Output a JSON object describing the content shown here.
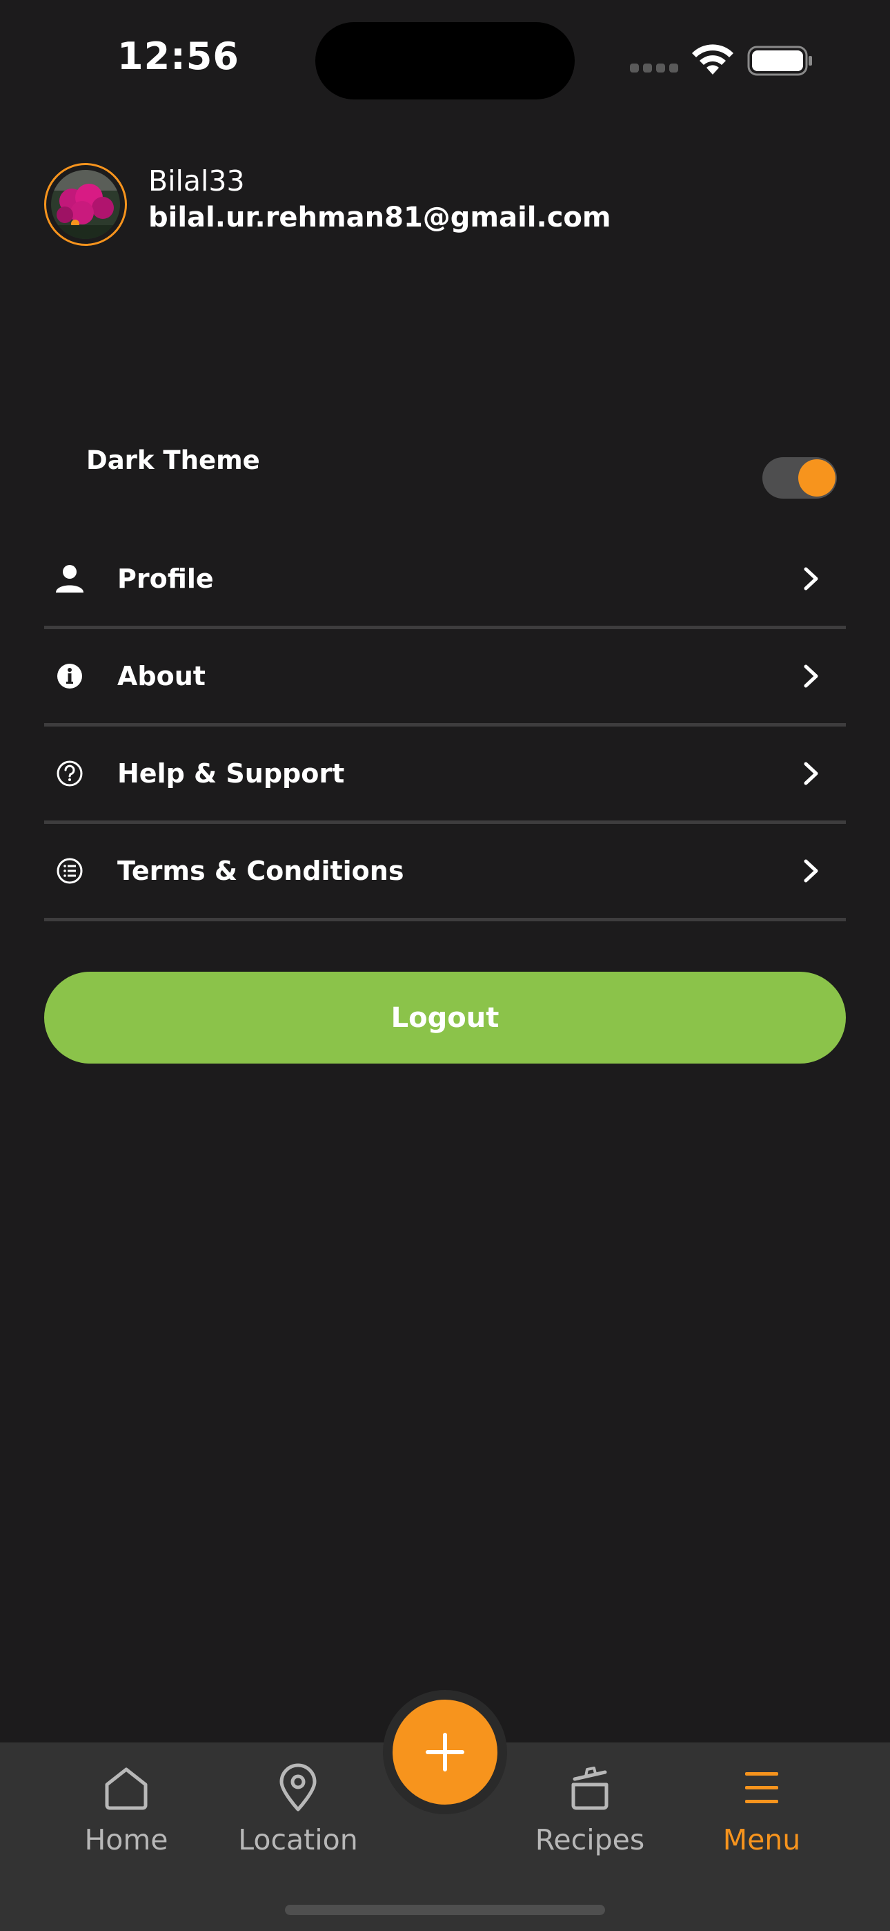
{
  "status_bar": {
    "time": "12:56"
  },
  "profile": {
    "username": "Bilal33",
    "email": "bilal.ur.rehman81@gmail.com"
  },
  "settings": {
    "dark_theme_label": "Dark Theme",
    "dark_theme_enabled": true
  },
  "menu": {
    "items": [
      {
        "label": "Profile",
        "icon": "person-icon"
      },
      {
        "label": "About",
        "icon": "info-icon"
      },
      {
        "label": "Help & Support",
        "icon": "help-icon"
      },
      {
        "label": "Terms & Conditions",
        "icon": "list-icon"
      }
    ]
  },
  "logout_label": "Logout",
  "bottom_nav": {
    "items": [
      {
        "label": "Home",
        "icon": "home-icon"
      },
      {
        "label": "Location",
        "icon": "location-pin-icon"
      },
      {
        "label": "Recipes",
        "icon": "cooking-pot-icon"
      },
      {
        "label": "Menu",
        "icon": "menu-icon",
        "active": true
      }
    ],
    "add_icon": "plus-icon"
  },
  "colors": {
    "background": "#1c1b1c",
    "accent": "#f7941d",
    "logout": "#8bc34a",
    "nav_background": "#333333"
  }
}
